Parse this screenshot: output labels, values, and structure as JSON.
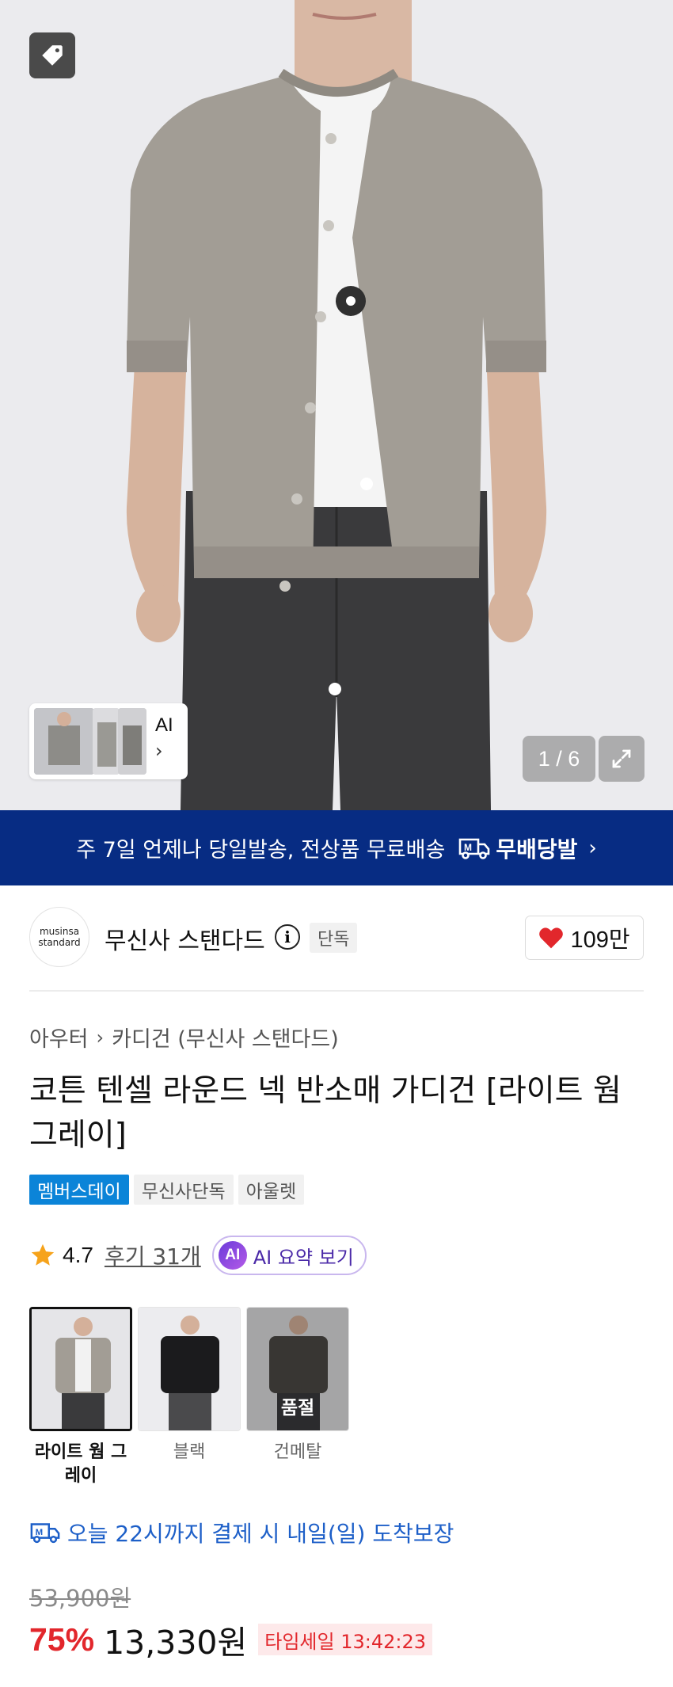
{
  "hero": {
    "thumb_ai_label": "AI",
    "thumb_chevron": "›",
    "counter": "1 / 6"
  },
  "banner": {
    "text": "주 7일 언제나 당일발송, 전상품 무료배송",
    "badge": "무배당발",
    "chevron": "›"
  },
  "brand": {
    "logo_line1": "musinsa",
    "logo_line2": "standard",
    "name": "무신사 스탠다드",
    "info_glyph": "i",
    "exclusive": "단독",
    "likes": "109만"
  },
  "product": {
    "breadcrumb": [
      "아우터",
      "카디건 (무신사 스탠다드)"
    ],
    "breadcrumb_sep": "›",
    "title": "코튼 텐셀 라운드 넥 반소매 가디건 [라이트 웜 그레이]",
    "tags": [
      "멤버스데이",
      "무신사단독",
      "아울렛"
    ],
    "rating": "4.7",
    "reviews": "후기 31개",
    "ai_badge": "AI",
    "ai_summary": "AI 요약 보기"
  },
  "colors": [
    {
      "label": "라이트 웜 그레이",
      "selected": true,
      "sold_out": false
    },
    {
      "label": "블랙",
      "selected": false,
      "sold_out": false
    },
    {
      "label": "건메탈",
      "selected": false,
      "sold_out": true,
      "sold_out_text": "품절"
    }
  ],
  "delivery": {
    "text": "오늘 22시까지 결제 시 내일(일) 도착보장"
  },
  "price": {
    "original": "53,900원",
    "discount": "75%",
    "current": "13,330원",
    "timesale": "타임세일 13:42:23"
  },
  "colors_theme": {
    "banner": "#072c83",
    "accent_red": "#e2272c",
    "tag_blue": "#0b84d8",
    "delivery_blue": "#1d5fc8"
  },
  "icons": [
    "tag-icon",
    "expand-icon",
    "truck-icon",
    "heart-icon",
    "star-icon",
    "info-icon"
  ]
}
